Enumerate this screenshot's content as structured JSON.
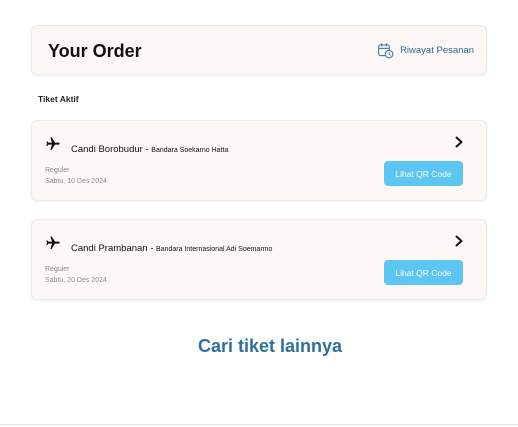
{
  "header": {
    "title": "Your Order",
    "history_label": "Riwayat Pesanan",
    "history_icon": "calendar-clock-icon"
  },
  "section_label": "Tiket Aktif",
  "tickets": [
    {
      "destination": "Candi Borobudur",
      "separator": " - ",
      "origin": "Bandara Soekarno Hatta",
      "class": "Reguler",
      "date": "Sabtu, 10 Des 2024",
      "button_label": "Lihat QR Code"
    },
    {
      "destination": "Candi Prambanan",
      "separator": " - ",
      "origin": "Bandara Internasional Adi Soemarmo",
      "class": "Reguler",
      "date": "Sabtu, 20 Des 2024",
      "button_label": "Lihat QR Code"
    }
  ],
  "more_link": "Cari tiket lainnya",
  "colors": {
    "accent": "#5bc6f2",
    "link": "#2f6f9e",
    "card_bg": "#fdf8f6"
  }
}
